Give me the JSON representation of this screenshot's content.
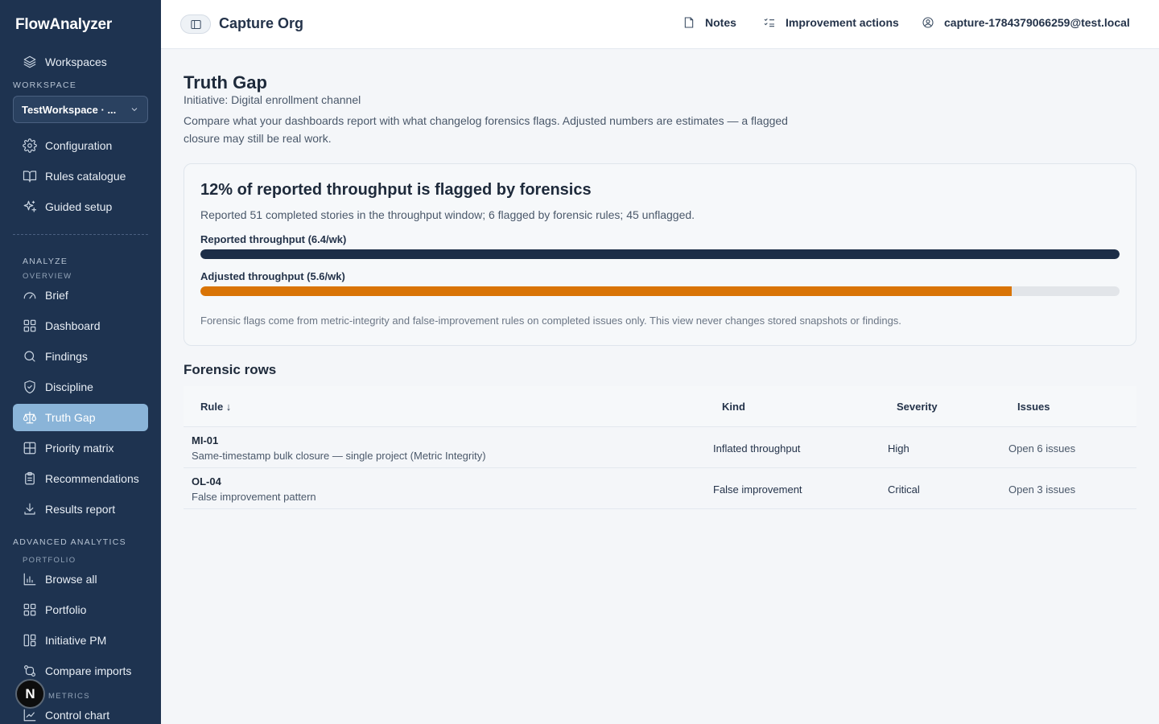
{
  "app": {
    "name": "FlowAnalyzer"
  },
  "sidebar": {
    "workspaces_label": "Workspaces",
    "workspace_section": "Workspace",
    "workspace_selected": "TestWorkspace · ...",
    "config_items": [
      {
        "label": "Configuration",
        "icon": "gear-icon"
      },
      {
        "label": "Rules catalogue",
        "icon": "book-icon"
      },
      {
        "label": "Guided setup",
        "icon": "sparkles-icon"
      }
    ],
    "analyze_section": "Analyze",
    "overview_sub": "Overview",
    "analyze_items": [
      {
        "label": "Brief",
        "icon": "gauge-icon"
      },
      {
        "label": "Dashboard",
        "icon": "grid-icon"
      },
      {
        "label": "Findings",
        "icon": "search-icon"
      },
      {
        "label": "Discipline",
        "icon": "shield-check-icon"
      },
      {
        "label": "Truth Gap",
        "icon": "scale-icon",
        "active": true
      },
      {
        "label": "Priority matrix",
        "icon": "table-grid-icon"
      },
      {
        "label": "Recommendations",
        "icon": "clipboard-icon"
      },
      {
        "label": "Results report",
        "icon": "download-icon"
      }
    ],
    "advanced_section": "Advanced analytics",
    "portfolio_sub": "Portfolio",
    "advanced_items": [
      {
        "label": "Browse all",
        "icon": "bar-chart-icon"
      },
      {
        "label": "Portfolio",
        "icon": "grid-icon"
      },
      {
        "label": "Initiative PM",
        "icon": "layout-icon"
      },
      {
        "label": "Compare imports",
        "icon": "git-compare-icon"
      }
    ],
    "metrics_sub": "Metrics",
    "metrics_items": [
      {
        "label": "Control chart",
        "icon": "line-chart-icon"
      }
    ],
    "avatar_letter": "N"
  },
  "topbar": {
    "org_title": "Capture Org",
    "notes_label": "Notes",
    "improvement_label": "Improvement actions",
    "user_email": "capture-1784379066259@test.local"
  },
  "page": {
    "title": "Truth Gap",
    "initiative": "Initiative: Digital enrollment channel",
    "description": "Compare what your dashboards report with what changelog forensics flags. Adjusted numbers are estimates — a flagged closure may still be real work."
  },
  "summary": {
    "headline": "12% of reported throughput is flagged by forensics",
    "subtext": "Reported 51 completed stories in the throughput window; 6 flagged by forensic rules; 45 unflagged.",
    "reported_label": "Reported throughput (6.4/wk)",
    "reported_fraction": 1.0,
    "reported_color": "#1c2d47",
    "adjusted_label": "Adjusted throughput (5.6/wk)",
    "adjusted_fraction": 0.8825,
    "adjusted_color": "#d97406",
    "note": "Forensic flags come from metric-integrity and false-improvement rules on completed issues only. This view never changes stored snapshots or findings."
  },
  "forensics": {
    "title": "Forensic rows",
    "columns": {
      "rule": "Rule ↓",
      "kind": "Kind",
      "severity": "Severity",
      "issues": "Issues"
    },
    "rows": [
      {
        "id": "MI-01",
        "desc": "Same-timestamp bulk closure — single project (Metric Integrity)",
        "kind": "Inflated throughput",
        "severity": "High",
        "issues": "Open 6 issues"
      },
      {
        "id": "OL-04",
        "desc": "False improvement pattern",
        "kind": "False improvement",
        "severity": "Critical",
        "issues": "Open 3 issues"
      }
    ]
  }
}
